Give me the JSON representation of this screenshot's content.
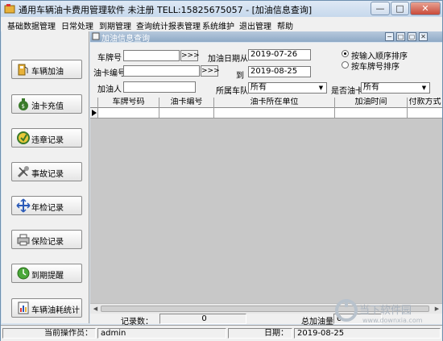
{
  "window": {
    "title": "通用车辆油卡费用管理软件 未注册 TELL:15825675057 - [加油信息查询]",
    "minimize": "—",
    "maximize": "□",
    "close": "✕"
  },
  "menu": {
    "items": [
      "基础数据管理",
      "日常处理",
      "到期管理",
      "查询统计报表管理",
      "系统维护",
      "退出管理",
      "帮助"
    ]
  },
  "sidebar": {
    "items": [
      {
        "label": "车辆加油",
        "icon": "fuel-pump-icon"
      },
      {
        "label": "油卡充值",
        "icon": "money-bag-icon"
      },
      {
        "label": "违章记录",
        "icon": "warning-sign-icon"
      },
      {
        "label": "事故记录",
        "icon": "wrench-icon"
      },
      {
        "label": "年检记录",
        "icon": "inspection-arrows-icon"
      },
      {
        "label": "保险记录",
        "icon": "printer-icon"
      },
      {
        "label": "到期提醒",
        "icon": "alarm-icon"
      },
      {
        "label": "车辆油耗统计",
        "icon": "report-icon"
      }
    ]
  },
  "child": {
    "title": "加油信息查询",
    "buttons": [
      "−",
      "□",
      "▢",
      "✕"
    ]
  },
  "form": {
    "plate_label": "车牌号",
    "plate_value": "",
    "card_label": "油卡编号",
    "card_value": "",
    "browse_label": ">>>",
    "date_from_label": "加油日期从",
    "date_from": "2019-07-26",
    "date_to_label": "到",
    "date_to": "2019-08-25",
    "person_label": "加油人",
    "person_value": "",
    "team_label": "所属车队",
    "team_value": "所有",
    "is_card_label": "是否油卡",
    "is_card_value": "所有",
    "sort_options": [
      "按输入顺序排序",
      "按车牌号排序"
    ],
    "sort_selected": 0
  },
  "grid": {
    "columns": [
      "车牌号码",
      "油卡编号",
      "油卡所在单位",
      "加油时间",
      "付款方式"
    ]
  },
  "bottom": {
    "count_label": "记录数：",
    "count_value": "0",
    "total_label": "总加油量",
    "total_value": "0"
  },
  "status": {
    "operator_label": "当前操作员：",
    "operator": "admin",
    "date_label": "日期：",
    "date": "2019-08-25"
  },
  "watermark": {
    "text": "当下软件园",
    "url": "www.downxia.com"
  },
  "colors": {
    "title_bar": "#c6d8ec",
    "child_title": "#8ea9c6",
    "close_button": "#c94a3a",
    "panel": "#f0f0f0",
    "grid_empty": "#c8c8c8"
  }
}
